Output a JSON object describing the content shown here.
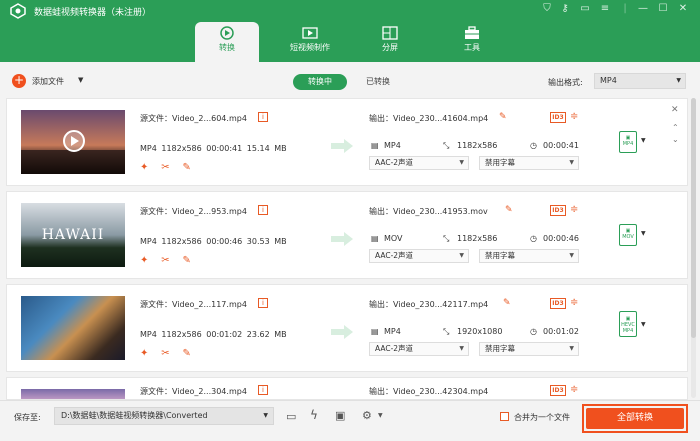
{
  "app": {
    "title": "数据蛙视频转换器（未注册）",
    "accent": "#2b9e57",
    "convert_color": "#f0501e"
  },
  "tabs": [
    {
      "label": "转换",
      "icon": "convert-icon",
      "active": true
    },
    {
      "label": "短视频制作",
      "icon": "short-video-icon",
      "active": false
    },
    {
      "label": "分屏",
      "icon": "split-screen-icon",
      "active": false
    },
    {
      "label": "工具",
      "icon": "toolbox-icon",
      "active": false
    }
  ],
  "toolbar": {
    "add_file": "添加文件",
    "converting": "转换中",
    "converted": "已转换",
    "output_format_label": "输出格式:",
    "output_format_value": "MP4"
  },
  "files": [
    {
      "source": "源文件：Video_2...604.mp4",
      "format": "MP4",
      "resolution": "1182x586",
      "duration": "00:00:41",
      "size": "15.14 MB",
      "output": "输出：Video_230...41604.mp4",
      "out_format": "MP4",
      "out_resolution": "1182x586",
      "out_duration": "00:00:41",
      "audio": "AAC-2声道",
      "subtitle": "禁用字幕",
      "format_badge": "MP4",
      "thumb_text": ""
    },
    {
      "source": "源文件：Video_2...953.mp4",
      "format": "MP4",
      "resolution": "1182x586",
      "duration": "00:00:46",
      "size": "30.53 MB",
      "output": "输出：Video_230...41953.mov",
      "out_format": "MOV",
      "out_resolution": "1182x586",
      "out_duration": "00:00:46",
      "audio": "AAC-2声道",
      "subtitle": "禁用字幕",
      "format_badge": "MOV",
      "thumb_text": "HAWAII"
    },
    {
      "source": "源文件：Video_2...117.mp4",
      "format": "MP4",
      "resolution": "1182x586",
      "duration": "00:01:02",
      "size": "23.62 MB",
      "output": "输出：Video_230...42117.mp4",
      "out_format": "MP4",
      "out_resolution": "1920x1080",
      "out_duration": "00:01:02",
      "audio": "AAC-2声道",
      "subtitle": "禁用字幕",
      "format_badge": "HEVC MP4",
      "thumb_text": ""
    },
    {
      "source": "源文件：Video_2...304.mp4",
      "output": "输出：Video_230...42304.mp4"
    }
  ],
  "bottom": {
    "save_to_label": "保存至:",
    "save_path": "D:\\数据蛙\\数据蛙视频转换器\\Converted",
    "merge_label": "合并为一个文件",
    "convert_all": "全部转换"
  }
}
